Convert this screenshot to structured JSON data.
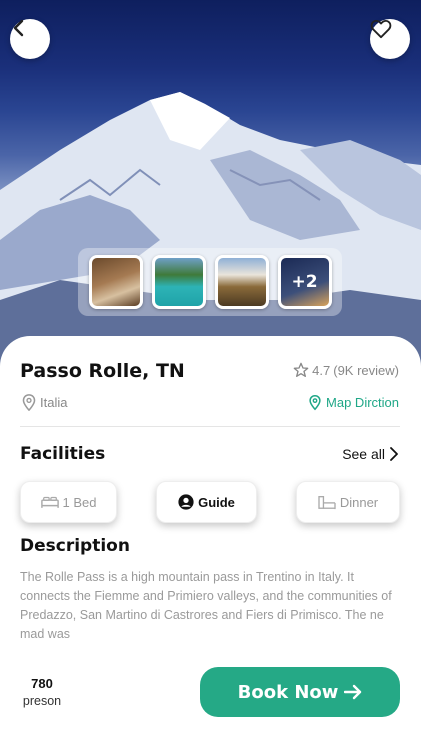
{
  "place": {
    "title": "Passo Rolle, TN",
    "rating": "4.7",
    "reviews": "(9K review)",
    "location": "Italia",
    "map_link": "Map Dirction"
  },
  "gallery": {
    "more_count": "+2"
  },
  "facilities": {
    "title": "Facilities",
    "see_all": "See all",
    "items": [
      {
        "label": "1 Bed",
        "icon": "bed-icon"
      },
      {
        "label": "Guide",
        "icon": "user-circle-icon",
        "selected": true
      },
      {
        "label": "Dinner",
        "icon": "dinner-icon"
      }
    ]
  },
  "description": {
    "title": "Description",
    "text": "The Rolle Pass is a high mountain pass in Trentino in Italy. It connects the Fiemme and Primiero valleys, and the communities of Predazzo, San Martino di Castrores and Fiers di Primisco. The ne mad was"
  },
  "booking": {
    "count": "780",
    "count_label": "preson",
    "button_label": "Book Now"
  },
  "colors": {
    "accent": "#25a986",
    "muted": "#9a9a9a",
    "hero_sky": "#1a2f7a"
  }
}
